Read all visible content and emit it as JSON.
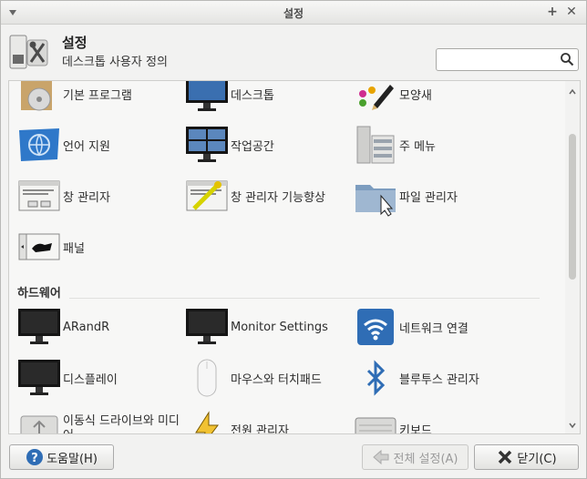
{
  "window": {
    "title": "설정"
  },
  "header": {
    "title": "설정",
    "subtitle": "데스크톱 사용자 정의",
    "search_placeholder": ""
  },
  "sections": [
    {
      "name": "",
      "items": [
        {
          "label": "기본 프로그램",
          "icon": "default-apps-icon"
        },
        {
          "label": "데스크톱",
          "icon": "desktop-icon"
        },
        {
          "label": "모양새",
          "icon": "appearance-icon"
        },
        {
          "label": "언어 지원",
          "icon": "language-icon"
        },
        {
          "label": "작업공간",
          "icon": "workspace-icon"
        },
        {
          "label": "주 메뉴",
          "icon": "main-menu-icon"
        },
        {
          "label": "창 관리자",
          "icon": "window-manager-icon"
        },
        {
          "label": "창 관리자 기능향상",
          "icon": "window-manager-tweaks-icon"
        },
        {
          "label": "파일 관리자",
          "icon": "file-manager-icon"
        },
        {
          "label": "패널",
          "icon": "panel-icon"
        }
      ]
    },
    {
      "name": "하드웨어",
      "items": [
        {
          "label": "ARandR",
          "icon": "monitor-icon"
        },
        {
          "label": "Monitor Settings",
          "icon": "monitor-icon"
        },
        {
          "label": "네트워크 연결",
          "icon": "wifi-icon"
        },
        {
          "label": "디스플레이",
          "icon": "monitor-icon"
        },
        {
          "label": "마우스와 터치패드",
          "icon": "mouse-icon"
        },
        {
          "label": "블루투스 관리자",
          "icon": "bluetooth-icon"
        },
        {
          "label": "이동식 드라이브와 미디어",
          "icon": "removable-drive-icon"
        },
        {
          "label": "전원 관리자",
          "icon": "power-icon"
        },
        {
          "label": "키보드",
          "icon": "keyboard-icon"
        }
      ]
    }
  ],
  "footer": {
    "help_label": "도움말(H)",
    "all_settings_label": "전체 설정(A)",
    "close_label": "닫기(C)"
  },
  "colors": {
    "accent_blue": "#2f6db5",
    "monitor_black": "#151515",
    "window_bg": "#f2f2f1"
  }
}
